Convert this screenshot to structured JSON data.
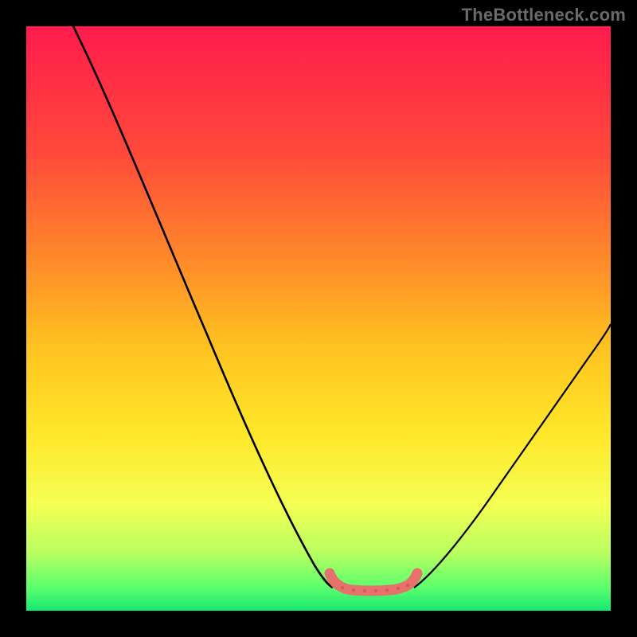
{
  "watermark": "TheBottleneck.com",
  "chart_data": {
    "type": "heatmap",
    "title": "",
    "xlabel": "",
    "ylabel": "",
    "xlim": [
      0,
      100
    ],
    "ylim": [
      0,
      100
    ],
    "gradient_stops": [
      {
        "pos": 0.0,
        "color": "#ff1b4d"
      },
      {
        "pos": 0.22,
        "color": "#ff4a3a"
      },
      {
        "pos": 0.4,
        "color": "#ff8a2a"
      },
      {
        "pos": 0.55,
        "color": "#ffc321"
      },
      {
        "pos": 0.7,
        "color": "#ffe82a"
      },
      {
        "pos": 0.82,
        "color": "#f4ff55"
      },
      {
        "pos": 0.9,
        "color": "#b9ff5f"
      },
      {
        "pos": 0.96,
        "color": "#5dff6f"
      },
      {
        "pos": 1.0,
        "color": "#16e86f"
      }
    ],
    "curves": [
      {
        "name": "left-branch",
        "color": "#000000",
        "points": [
          {
            "x": 8,
            "y": 99
          },
          {
            "x": 14,
            "y": 88
          },
          {
            "x": 21,
            "y": 72
          },
          {
            "x": 28,
            "y": 56
          },
          {
            "x": 34,
            "y": 40
          },
          {
            "x": 40,
            "y": 26
          },
          {
            "x": 46,
            "y": 13
          },
          {
            "x": 50,
            "y": 6
          }
        ]
      },
      {
        "name": "right-branch",
        "color": "#000000",
        "points": [
          {
            "x": 65,
            "y": 6
          },
          {
            "x": 70,
            "y": 12
          },
          {
            "x": 76,
            "y": 22
          },
          {
            "x": 82,
            "y": 32
          },
          {
            "x": 88,
            "y": 42
          },
          {
            "x": 94,
            "y": 52
          },
          {
            "x": 99,
            "y": 60
          }
        ]
      }
    ],
    "flat_band": {
      "name": "valley-highlight",
      "color": "#e7716c",
      "x_range": [
        50,
        65
      ],
      "y": 4.5,
      "thickness": 2.8
    }
  }
}
